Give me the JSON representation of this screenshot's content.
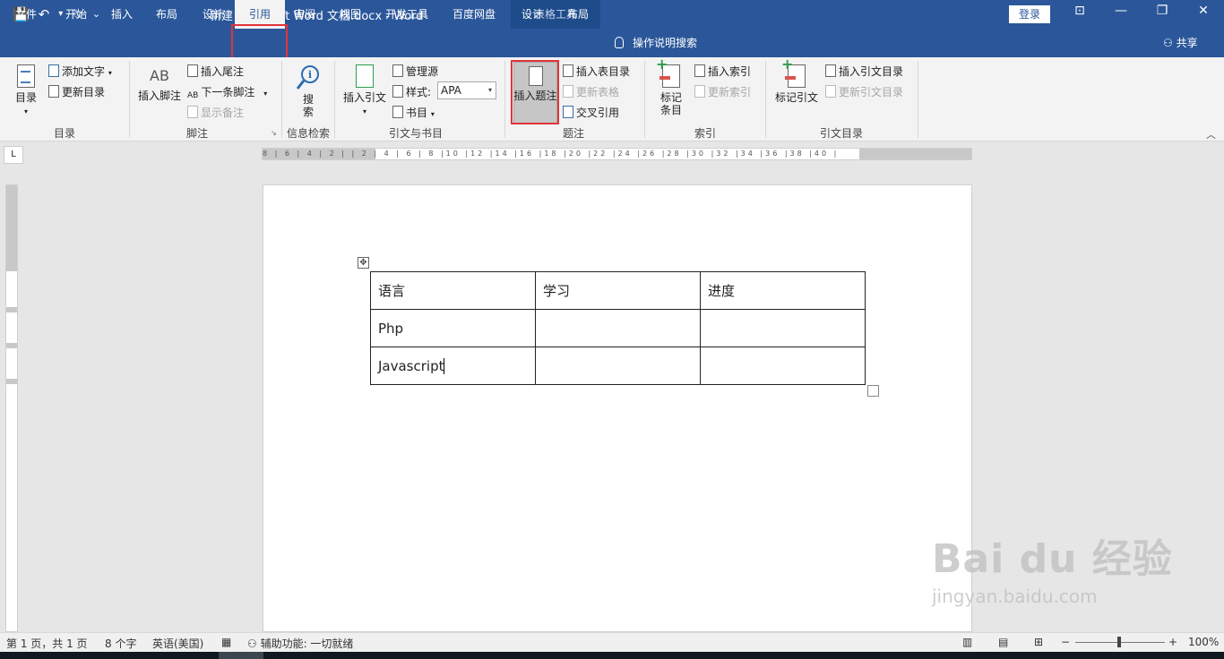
{
  "window": {
    "title": "新建 Microsoft Word 文档.docx  -  Word",
    "context_tools": "表格工具",
    "login": "登录",
    "minimize": "—",
    "restore": "❐",
    "close": "✕",
    "ribbon_display": "⊡"
  },
  "qat": {
    "save": "💾",
    "undo": "↶",
    "undo_arrow": "▾",
    "redo": "↻",
    "customize": "⌄"
  },
  "tabs": [
    "文件",
    "开始",
    "插入",
    "布局",
    "设计",
    "引用",
    "审阅",
    "视图",
    "开发工具",
    "百度网盘",
    "设计",
    "布局"
  ],
  "active_tab": "引用",
  "tell_me": "操作说明搜索",
  "share": "共享",
  "ribbon": {
    "toc": {
      "label": "目录",
      "add_text": "添加文字",
      "update_toc": "更新目录",
      "group": "目录"
    },
    "footnotes": {
      "insert_footnote": "插入脚注",
      "ab_icon": "AB",
      "insert_endnote": "插入尾注",
      "next_footnote": "下一条脚注",
      "show_notes": "显示备注",
      "group": "脚注"
    },
    "research": {
      "search_line1": "搜",
      "search_line2": "索",
      "group": "信息检索"
    },
    "citations": {
      "insert_citation": "插入引文",
      "manage_sources": "管理源",
      "style_label": "样式:",
      "style_value": "APA",
      "bibliography": "书目",
      "group": "引文与书目"
    },
    "captions": {
      "insert_caption": "插入题注",
      "insert_table_of_figures": "插入表目录",
      "update_table": "更新表格",
      "cross_reference": "交叉引用",
      "group": "题注"
    },
    "index": {
      "mark_entry_line1": "标记",
      "mark_entry_line2": "条目",
      "insert_index": "插入索引",
      "update_index": "更新索引",
      "group": "索引"
    },
    "toa": {
      "mark_citation": "标记引文",
      "insert_toa": "插入引文目录",
      "update_toa": "更新引文目录",
      "group": "引文目录"
    }
  },
  "ruler": {
    "corner": "L",
    "ticks": "8 | 6 | 4 | 2 |   | 2 | 4 | 6 | 8 |10 |12 |14 |16 |18 |20 |22 |24 |26 |28 |30 |32 |34 |36 |38 |40 |"
  },
  "table": {
    "rows": [
      [
        "语言",
        "学习",
        "进度"
      ],
      [
        "Php",
        "",
        ""
      ],
      [
        "Javascript",
        "",
        ""
      ]
    ]
  },
  "statusbar": {
    "page": "第 1 页，共 1 页",
    "words": "8 个字",
    "language": "英语(美国)",
    "accessibility": "辅助功能: 一切就绪",
    "zoom": "100%",
    "zoom_minus": "−",
    "zoom_plus": "+"
  },
  "watermark": {
    "main": "Bai du 经验",
    "sub": "jingyan.baidu.com"
  }
}
